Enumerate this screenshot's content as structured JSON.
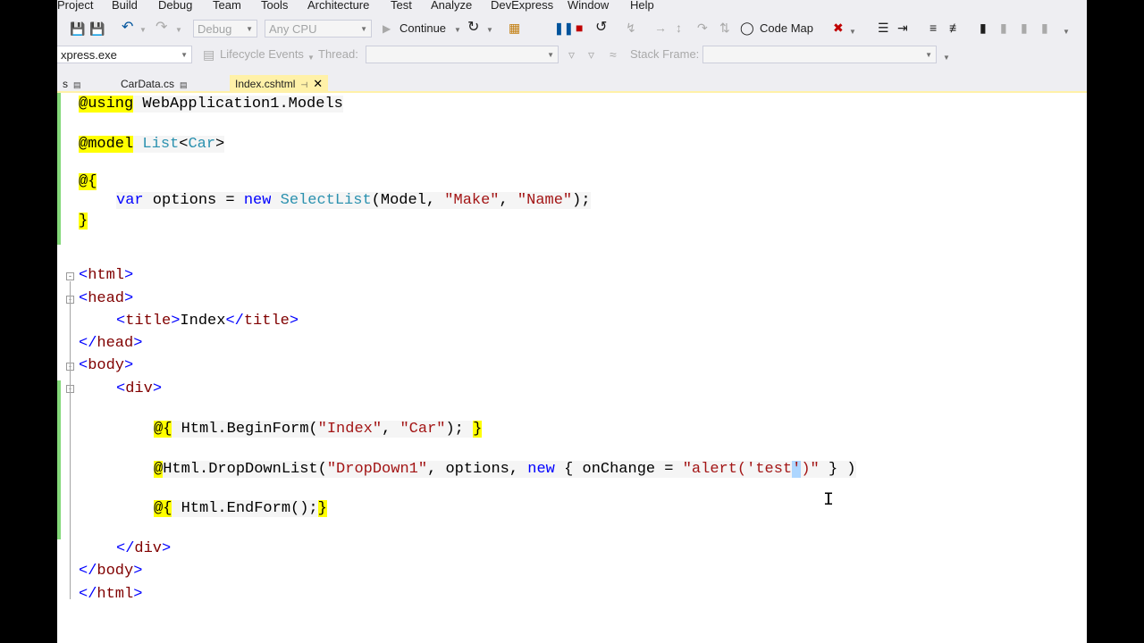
{
  "menu": [
    "Project",
    "Build",
    "Debug",
    "Team",
    "Tools",
    "Architecture",
    "Test",
    "Analyze",
    "DevExpress",
    "Window",
    "Help"
  ],
  "toolbar": {
    "config": "Debug",
    "platform": "Any CPU",
    "continue": "Continue",
    "code_map": "Code Map"
  },
  "debug_bar": {
    "process": "xpress.exe",
    "lifecycle": "Lifecycle Events",
    "thread_label": "Thread:",
    "stack_label": "Stack Frame:"
  },
  "tabs": [
    {
      "label": "s"
    },
    {
      "label": "CarData.cs"
    },
    {
      "label": "Index.cshtml",
      "active": true
    }
  ],
  "code": {
    "l1_at": "@using",
    "l1_ns": " WebApplication1.Models",
    "l2_at": "@model",
    "l2_type": "List",
    "l2_lt": "<",
    "l2_car": "Car",
    "l2_gt": ">",
    "l3": "@{",
    "l4_var": "var",
    "l4_mid": " options = ",
    "l4_new": "new",
    "l4_sl": "SelectList",
    "l4_args1": "(Model, ",
    "l4_s1": "\"Make\"",
    "l4_comma": ", ",
    "l4_s2": "\"Name\"",
    "l4_end": ");",
    "l5": "}",
    "html_open": "html",
    "head_open": "head",
    "title_open": "title",
    "title_text": "Index",
    "title_close": "title",
    "head_close": "head",
    "body_open": "body",
    "div_open": "div",
    "bf_at": "@{",
    "bf_mid": " Html.BeginForm(",
    "bf_s1": "\"Index\"",
    "bf_c": ", ",
    "bf_s2": "\"Car\"",
    "bf_end": "); ",
    "bf_close": "}",
    "dd_at": "@",
    "dd_mid": "Html.DropDownList(",
    "dd_s1": "\"DropDown1\"",
    "dd_opt": ", options, ",
    "dd_new": "new",
    "dd_obj": " { onChange = ",
    "dd_s2a": "\"alert('test",
    "dd_sel": "'",
    "dd_s2b": ")\"",
    "dd_end": " } )",
    "ef_at": "@{",
    "ef_mid": " Html.EndForm();",
    "ef_close": "}",
    "div_close": "div",
    "body_close": "body",
    "html_close": "html"
  }
}
